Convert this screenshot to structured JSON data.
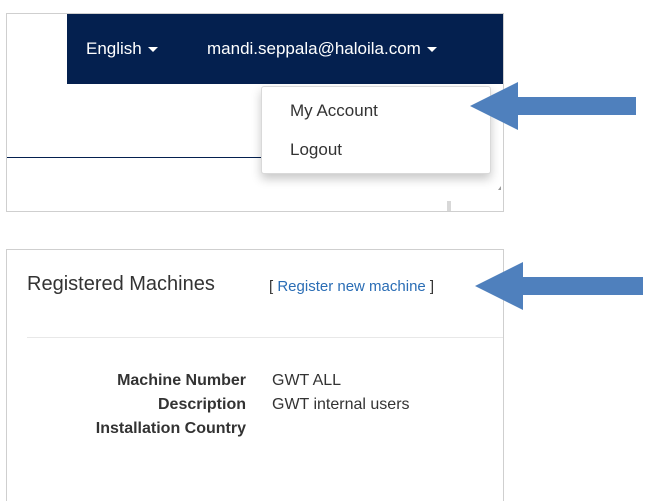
{
  "navbar": {
    "language_label": "English",
    "user_email": "mandi.seppala@haloila.com"
  },
  "user_menu": {
    "items": [
      {
        "label": "My Account"
      },
      {
        "label": "Logout"
      }
    ]
  },
  "machines": {
    "title": "Registered Machines",
    "register_open_bracket": "[",
    "register_link": "Register new machine",
    "register_close_bracket": "]",
    "details": [
      {
        "label": "Machine Number",
        "value": "GWT ALL"
      },
      {
        "label": "Description",
        "value": "GWT internal users"
      },
      {
        "label": "Installation Country",
        "value": ""
      }
    ]
  },
  "colors": {
    "navbar_bg": "#04204f",
    "link": "#2a6db5",
    "arrow": "#4f80bd"
  },
  "icons": {
    "caret": "caret-down-icon",
    "pointer": "arrow-left-icon"
  }
}
